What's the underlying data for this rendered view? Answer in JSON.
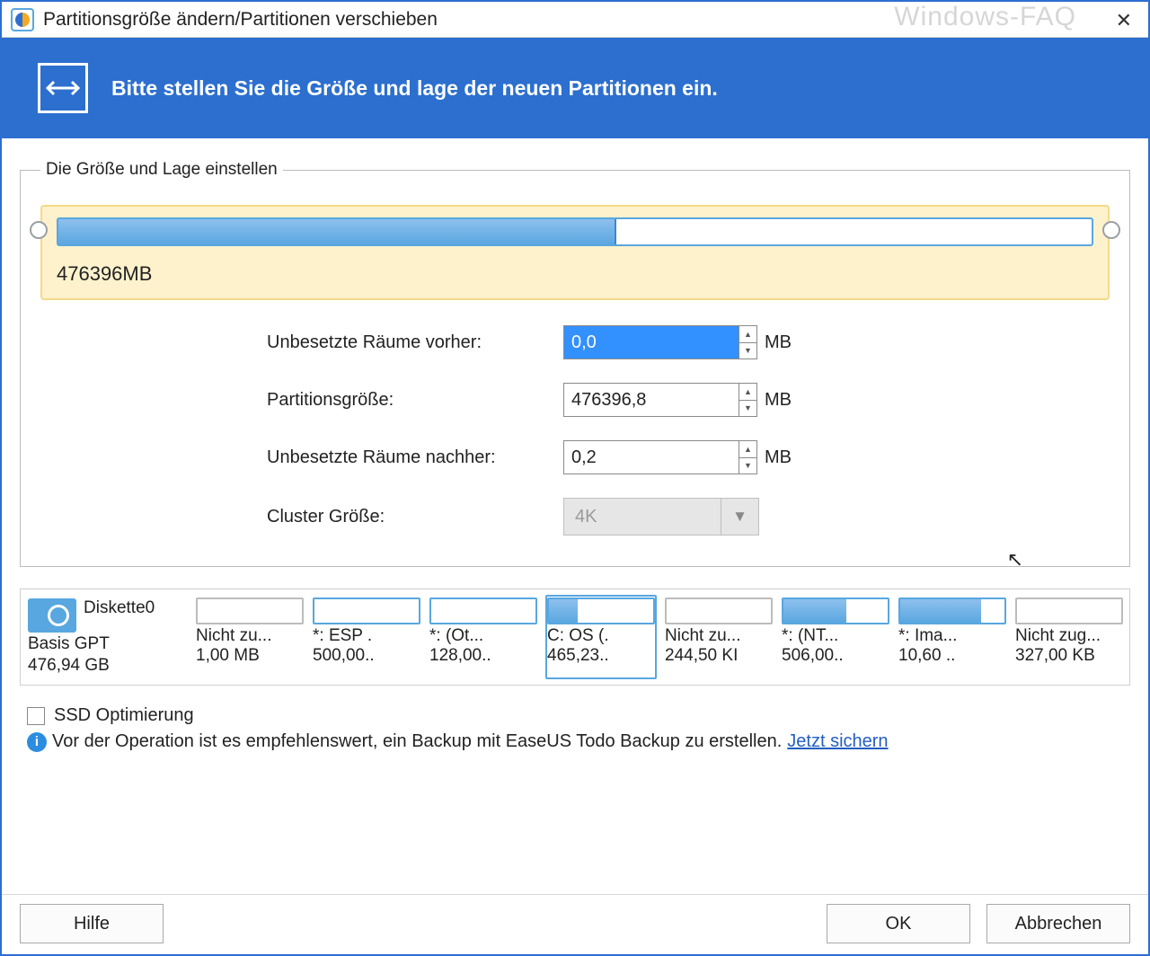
{
  "titlebar": {
    "title": "Partitionsgröße ändern/Partitionen verschieben",
    "watermark": "Windows-FAQ",
    "close": "✕"
  },
  "banner": {
    "text": "Bitte stellen Sie die Größe und lage der neuen Partitionen ein."
  },
  "fieldset": {
    "legend": "Die Größe und Lage einstellen",
    "bar_size_label": "476396MB",
    "bar_fill_pct": 54
  },
  "fields": {
    "before_label": "Unbesetzte Räume vorher:",
    "before_value": "0,0",
    "before_unit": "MB",
    "size_label": "Partitionsgröße:",
    "size_value": "476396,8",
    "size_unit": "MB",
    "after_label": "Unbesetzte Räume nachher:",
    "after_value": "0,2",
    "after_unit": "MB",
    "cluster_label": "Cluster Größe:",
    "cluster_value": "4K"
  },
  "disk": {
    "name": "Diskette0",
    "type": "Basis GPT",
    "capacity": "476,94 GB",
    "partitions": [
      {
        "label": "Nicht zu...",
        "size": "1,00 MB",
        "fill": 0,
        "blue": false,
        "selected": false
      },
      {
        "label": "*: ESP .",
        "size": "500,00..",
        "fill": 0,
        "blue": true,
        "selected": false
      },
      {
        "label": "*: (Ot...",
        "size": "128,00..",
        "fill": 0,
        "blue": true,
        "selected": false
      },
      {
        "label": "C: OS (.",
        "size": "465,23..",
        "fill": 28,
        "blue": true,
        "selected": true
      },
      {
        "label": "Nicht zu...",
        "size": "244,50 KI",
        "fill": 0,
        "blue": false,
        "selected": false
      },
      {
        "label": "*: (NT...",
        "size": "506,00..",
        "fill": 60,
        "blue": true,
        "selected": false
      },
      {
        "label": "*: Ima...",
        "size": "10,60 ..",
        "fill": 78,
        "blue": true,
        "selected": false
      },
      {
        "label": "Nicht zug...",
        "size": "327,00 KB",
        "fill": 0,
        "blue": false,
        "selected": false
      }
    ]
  },
  "options": {
    "ssd_label": "SSD Optimierung",
    "info_text_a": "Vor der Operation ist es empfehlenswert, ein Backup mit  EaseUS Todo Backup zu erstellen. ",
    "info_link": "Jetzt sichern"
  },
  "footer": {
    "help": "Hilfe",
    "ok": "OK",
    "cancel": "Abbrechen"
  }
}
